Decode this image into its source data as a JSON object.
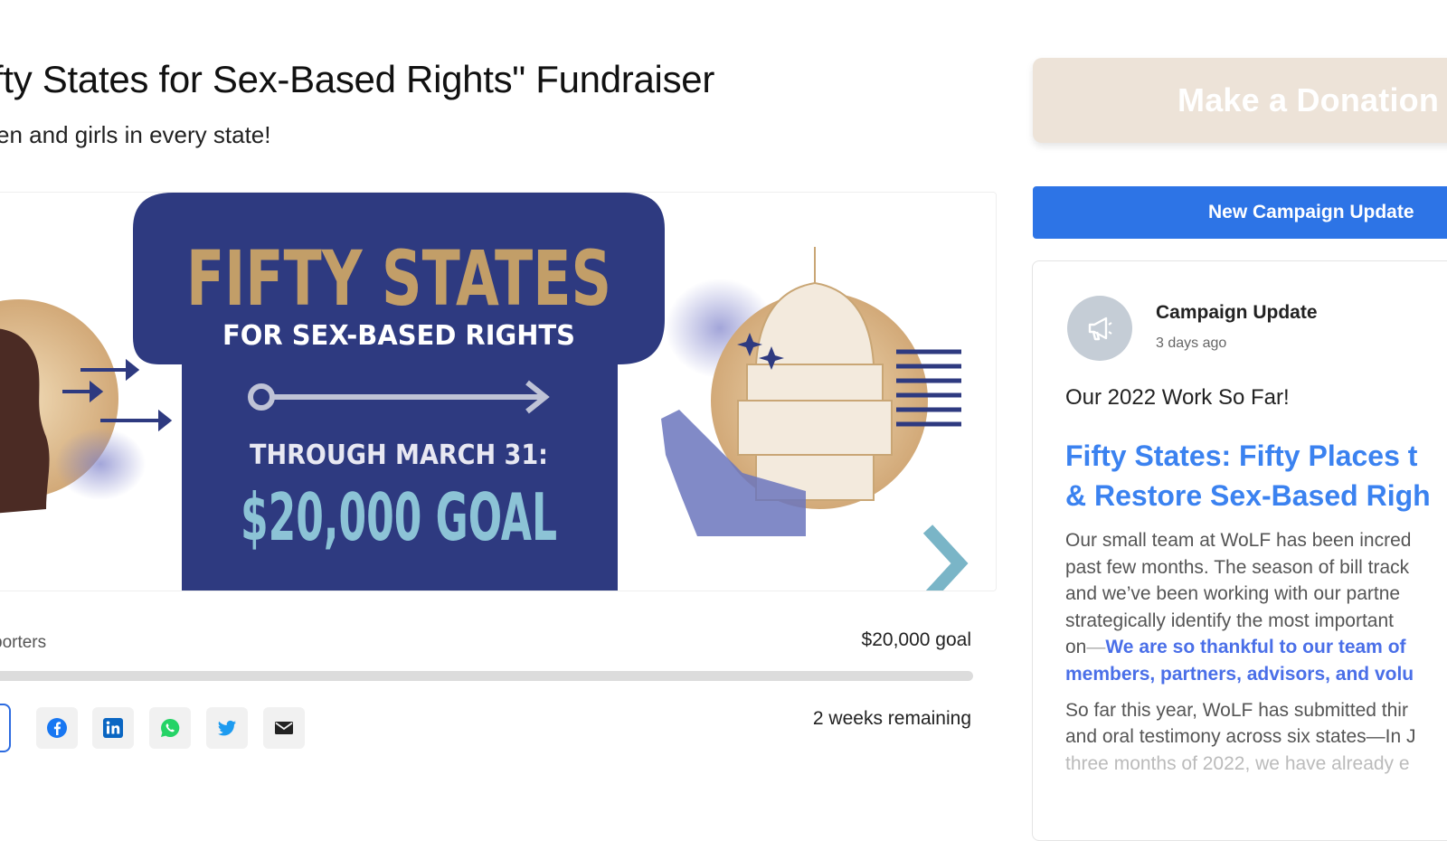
{
  "header": {
    "title": "fty States for Sex-Based Rights\" Fundraiser",
    "subtitle": "en and girls in every state!"
  },
  "banner": {
    "headline": "FIFTY STATES",
    "tagline": "FOR SEX-BASED RIGHTS",
    "date_line": "THROUGH MARCH 31:",
    "goal_line": "$20,000 GOAL",
    "colors": {
      "navy": "#2e3a80",
      "tan": "#c29e68",
      "light_blue": "#8cc3d6",
      "teal_arrow": "#7ab5c7"
    }
  },
  "progress": {
    "supporters_label": "porters",
    "goal_label": "$20,000 goal",
    "remaining_label": "2 weeks remaining",
    "fraction": 0
  },
  "share": {
    "icons": [
      "facebook-icon",
      "linkedin-icon",
      "whatsapp-icon",
      "twitter-icon",
      "email-icon"
    ]
  },
  "sidebar": {
    "donate_label": "Make a Donation",
    "update_button_label": "New Campaign Update",
    "card": {
      "type": "Campaign Update",
      "time": "3 days ago",
      "heading": "Our 2022 Work So Far!",
      "link_line1": "Fifty States: Fifty Places t",
      "link_line2": "& Restore Sex-Based Righ",
      "body_lines": [
        "Our small team at WoLF has been incred",
        "past few months. The season of bill track",
        "and we’ve been working with our partne",
        "strategically identify the most important"
      ],
      "body_on": "on",
      "body_dash": "—",
      "body_strong1": "We are so thankful to our team of",
      "body_strong2": "members, partners, advisors, and volu",
      "body2_line1": "So far this year, WoLF has submitted thir",
      "body2_line2": "and oral testimony across six states—In J",
      "body2_line3": "three months of 2022, we have already e"
    }
  }
}
